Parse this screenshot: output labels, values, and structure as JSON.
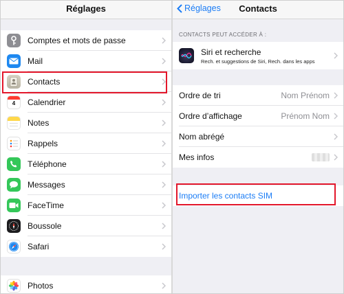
{
  "left": {
    "title": "Réglages",
    "items": [
      {
        "label": "Comptes et mots de passe",
        "icon": "key-icon",
        "color": "#8e8e93"
      },
      {
        "label": "Mail",
        "icon": "mail-icon",
        "color": "#1e88f0"
      },
      {
        "label": "Contacts",
        "icon": "contacts-icon",
        "color": "#c9c4b4"
      },
      {
        "label": "Calendrier",
        "icon": "calendar-icon",
        "color": "#ffffff"
      },
      {
        "label": "Notes",
        "icon": "notes-icon",
        "color": "#ffd84a"
      },
      {
        "label": "Rappels",
        "icon": "reminders-icon",
        "color": "#ffffff"
      },
      {
        "label": "Téléphone",
        "icon": "phone-icon",
        "color": "#34c759"
      },
      {
        "label": "Messages",
        "icon": "messages-icon",
        "color": "#34c759"
      },
      {
        "label": "FaceTime",
        "icon": "facetime-icon",
        "color": "#34c759"
      },
      {
        "label": "Boussole",
        "icon": "compass-icon",
        "color": "#1c1c1e"
      },
      {
        "label": "Safari",
        "icon": "safari-icon",
        "color": "#ffffff"
      }
    ],
    "photos": {
      "label": "Photos",
      "icon": "photos-icon"
    }
  },
  "right": {
    "back_label": "Réglages",
    "title": "Contacts",
    "section_header": "CONTACTS PEUT ACCÉDER À :",
    "siri": {
      "title": "Siri et recherche",
      "subtitle": "Rech. et suggestions de Siri, Rech. dans les apps"
    },
    "rows": [
      {
        "label": "Ordre de tri",
        "value": "Nom Prénom"
      },
      {
        "label": "Ordre d’affichage",
        "value": "Prénom Nom"
      },
      {
        "label": "Nom abrégé",
        "value": ""
      },
      {
        "label": "Mes infos",
        "value": ""
      }
    ],
    "import_label": "Importer les contacts SIM"
  },
  "colors": {
    "accent": "#1a7cf5",
    "highlight": "#e3162a"
  }
}
